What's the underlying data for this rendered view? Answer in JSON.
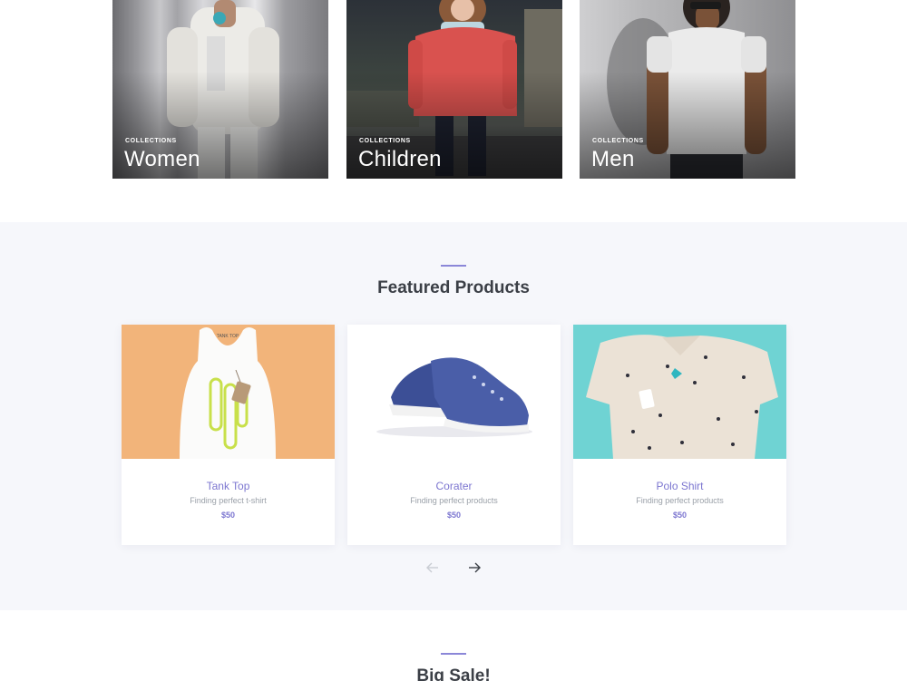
{
  "collections": [
    {
      "eyebrow": "COLLECTIONS",
      "name": "Women"
    },
    {
      "eyebrow": "COLLECTIONS",
      "name": "Children"
    },
    {
      "eyebrow": "COLLECTIONS",
      "name": "Men"
    }
  ],
  "featured": {
    "title": "Featured Products",
    "products": [
      {
        "name": "Tank Top",
        "subtitle": "Finding perfect t-shirt",
        "price": "$50",
        "image": "tank-top-image",
        "image_bg": "#f2b47a"
      },
      {
        "name": "Corater",
        "subtitle": "Finding perfect products",
        "price": "$50",
        "image": "sneaker-image",
        "image_bg": "#ffffff"
      },
      {
        "name": "Polo Shirt",
        "subtitle": "Finding perfect products",
        "price": "$50",
        "image": "polo-shirt-image",
        "image_bg": "#6fd3d3"
      }
    ],
    "prev_icon": "arrow-left-icon",
    "next_icon": "arrow-right-icon",
    "tag_text": "TANK TOP"
  },
  "bigsale": {
    "title": "Big Sale!"
  },
  "colors": {
    "accent": "#7c76d0",
    "section_bg": "#f6f7fb",
    "heading": "#3b3f46"
  }
}
